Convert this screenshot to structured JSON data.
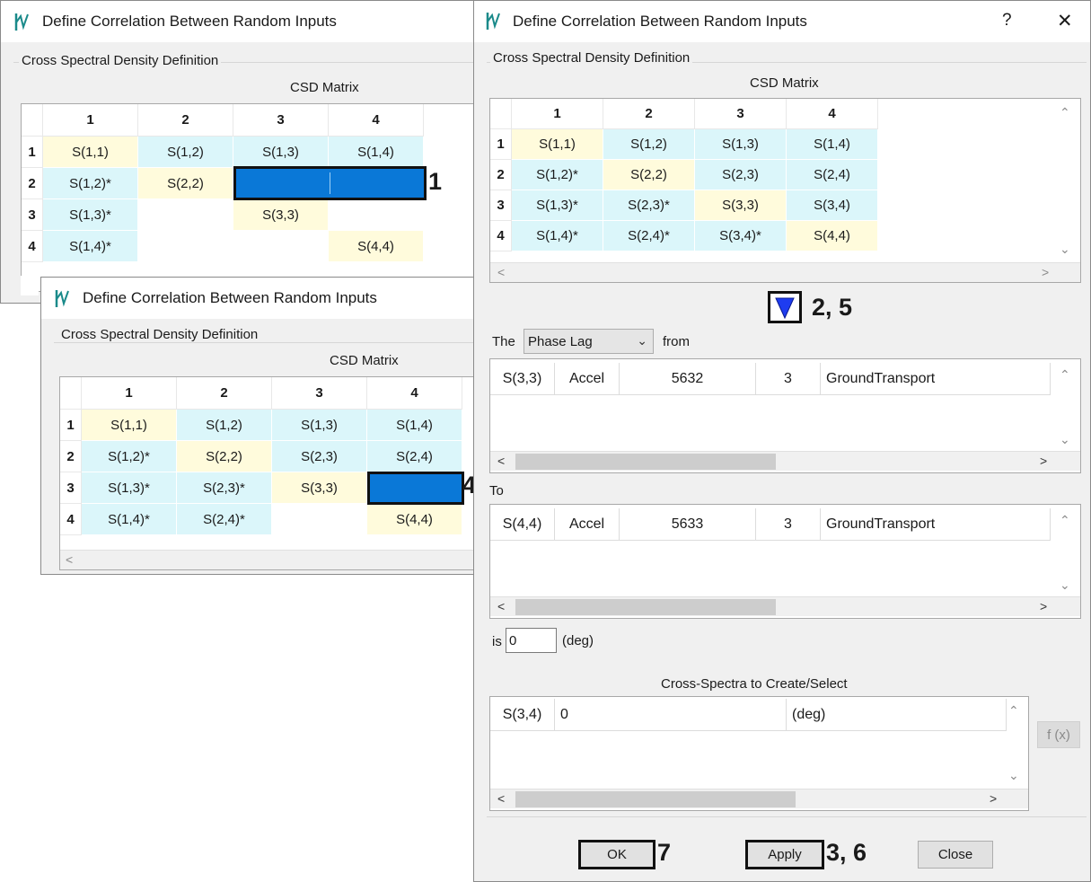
{
  "window_title": "Define Correlation Between Random Inputs",
  "group_label": "Cross Spectral Density Definition",
  "csd_label": "CSD Matrix",
  "help_label": "?",
  "close_label": "✕",
  "column_headers": [
    "1",
    "2",
    "3",
    "4"
  ],
  "row_headers": [
    "1",
    "2",
    "3",
    "4"
  ],
  "matrix_a": [
    [
      "S(1,1)",
      "S(1,2)",
      "S(1,3)",
      "S(1,4)"
    ],
    [
      "S(1,2)*",
      "S(2,2)",
      "",
      ""
    ],
    [
      "S(1,3)*",
      "",
      "S(3,3)",
      ""
    ],
    [
      "S(1,4)*",
      "",
      "",
      "S(4,4)"
    ]
  ],
  "matrix_b": [
    [
      "S(1,1)",
      "S(1,2)",
      "S(1,3)",
      "S(1,4)"
    ],
    [
      "S(1,2)*",
      "S(2,2)",
      "S(2,3)",
      "S(2,4)"
    ],
    [
      "S(1,3)*",
      "S(2,3)*",
      "S(3,3)",
      ""
    ],
    [
      "S(1,4)*",
      "S(2,4)*",
      "",
      "S(4,4)"
    ]
  ],
  "matrix_c": [
    [
      "S(1,1)",
      "S(1,2)",
      "S(1,3)",
      "S(1,4)"
    ],
    [
      "S(1,2)*",
      "S(2,2)",
      "S(2,3)",
      "S(2,4)"
    ],
    [
      "S(1,3)*",
      "S(2,3)*",
      "S(3,3)",
      "S(3,4)"
    ],
    [
      "S(1,4)*",
      "S(2,4)*",
      "S(3,4)*",
      "S(4,4)"
    ]
  ],
  "callouts": {
    "c1": "1",
    "c25": "2, 5",
    "c4": "4",
    "c7": "7",
    "c36": "3, 6"
  },
  "phase": {
    "the_label": "The",
    "select_value": "Phase Lag",
    "from_label": "from",
    "to_label": "To",
    "is_label": "is",
    "is_value": "0",
    "unit_label": "(deg)"
  },
  "from_row": [
    "S(3,3)",
    "Accel",
    "5632",
    "3",
    "GroundTransport"
  ],
  "to_row": [
    "S(4,4)",
    "Accel",
    "5633",
    "3",
    "GroundTransport"
  ],
  "cross_spectra": {
    "label": "Cross-Spectra to Create/Select",
    "row": [
      "S(3,4)",
      "0",
      "(deg)"
    ]
  },
  "fx_label": "f (x)",
  "buttons": {
    "ok": "OK",
    "apply": "Apply",
    "close": "Close"
  },
  "colors": {
    "cell_cyan": "#dbf6fa",
    "cell_yellow": "#fffbdc",
    "selection_blue": "#0a78d7",
    "dialog_bg": "#f0f0f0"
  }
}
